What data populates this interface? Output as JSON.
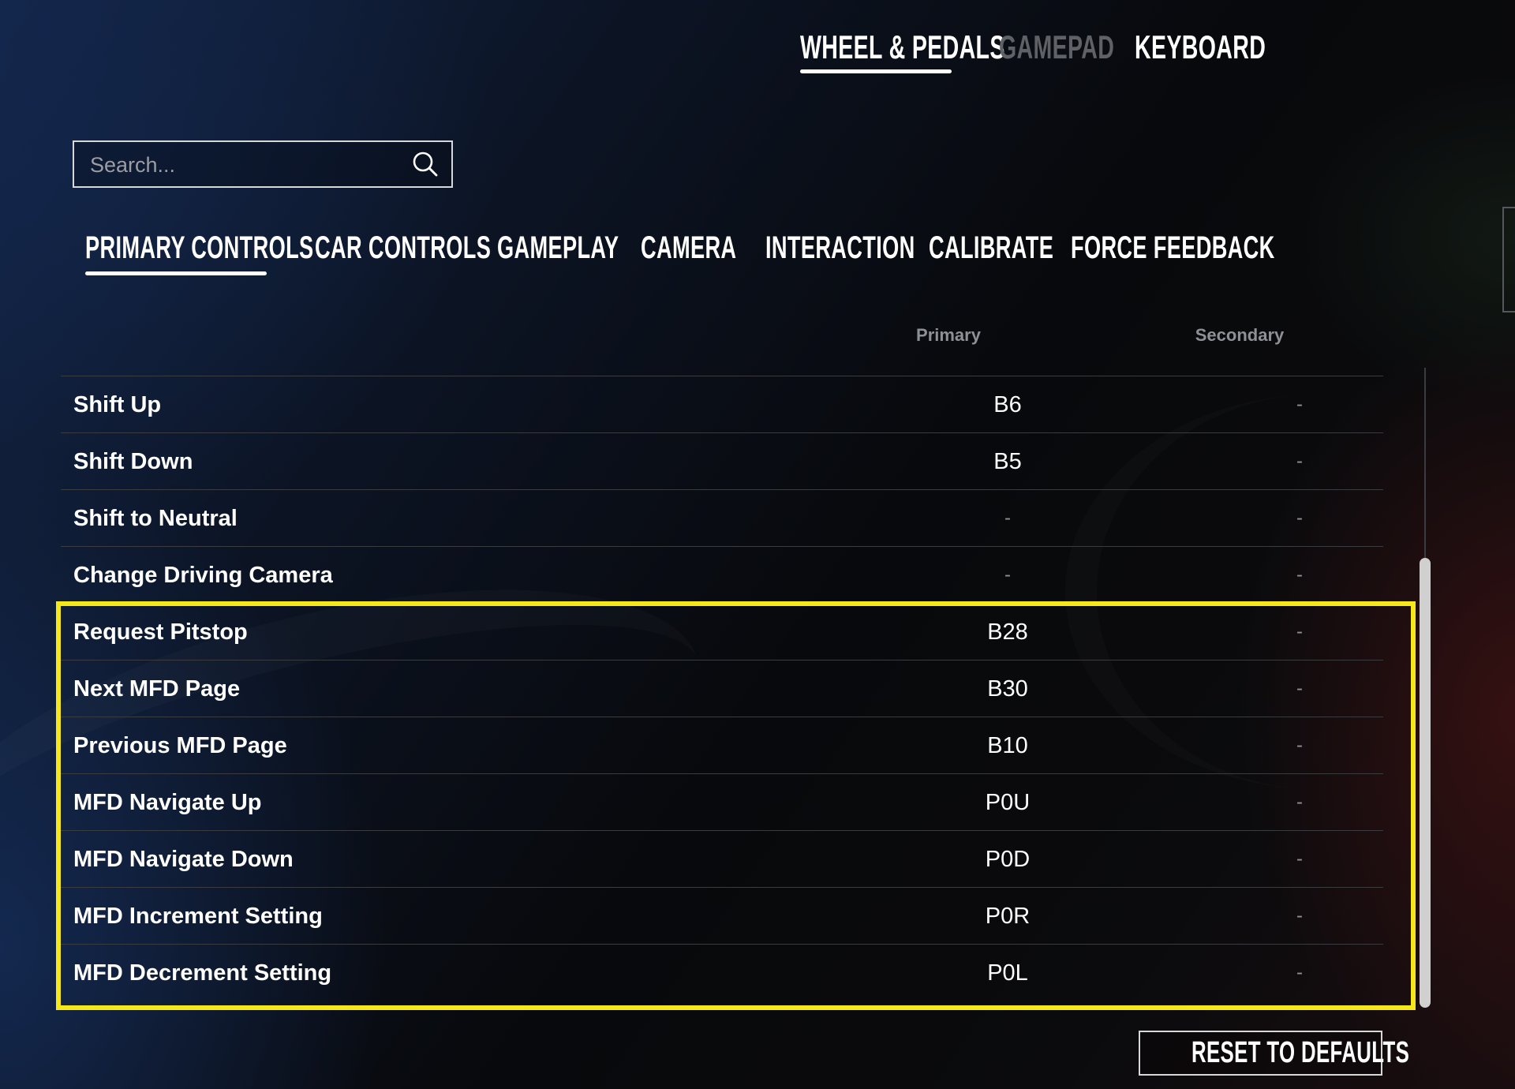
{
  "top_tabs": [
    {
      "label": "WHEEL & PEDALS",
      "state": "active"
    },
    {
      "label": "GAMEPAD",
      "state": "disabled"
    },
    {
      "label": "KEYBOARD",
      "state": "normal"
    }
  ],
  "search": {
    "placeholder": "Search...",
    "value": "",
    "icon": "search-icon"
  },
  "sub_tabs": [
    {
      "label": "PRIMARY CONTROLS",
      "state": "active"
    },
    {
      "label": "CAR CONTROLS",
      "state": "normal"
    },
    {
      "label": "GAMEPLAY",
      "state": "normal"
    },
    {
      "label": "CAMERA",
      "state": "normal"
    },
    {
      "label": "INTERACTION",
      "state": "normal"
    },
    {
      "label": "CALIBRATE",
      "state": "normal"
    },
    {
      "label": "FORCE FEEDBACK",
      "state": "normal"
    }
  ],
  "table": {
    "headers": {
      "primary": "Primary",
      "secondary": "Secondary"
    },
    "rows": [
      {
        "action": "Shift Up",
        "primary": "B6",
        "secondary": "-"
      },
      {
        "action": "Shift Down",
        "primary": "B5",
        "secondary": "-"
      },
      {
        "action": "Shift to Neutral",
        "primary": "-",
        "secondary": "-"
      },
      {
        "action": "Change Driving Camera",
        "primary": "-",
        "secondary": "-"
      },
      {
        "action": "Request Pitstop",
        "primary": "B28",
        "secondary": "-"
      },
      {
        "action": "Next MFD Page",
        "primary": "B30",
        "secondary": "-"
      },
      {
        "action": "Previous MFD Page",
        "primary": "B10",
        "secondary": "-"
      },
      {
        "action": "MFD Navigate Up",
        "primary": "P0U",
        "secondary": "-"
      },
      {
        "action": "MFD Navigate Down",
        "primary": "P0D",
        "secondary": "-"
      },
      {
        "action": "MFD Increment Setting",
        "primary": "P0R",
        "secondary": "-"
      },
      {
        "action": "MFD Decrement Setting",
        "primary": "P0L",
        "secondary": "-"
      }
    ]
  },
  "highlight_color": "#f5e71a",
  "reset_button": {
    "label": "RESET TO DEFAULTS"
  }
}
